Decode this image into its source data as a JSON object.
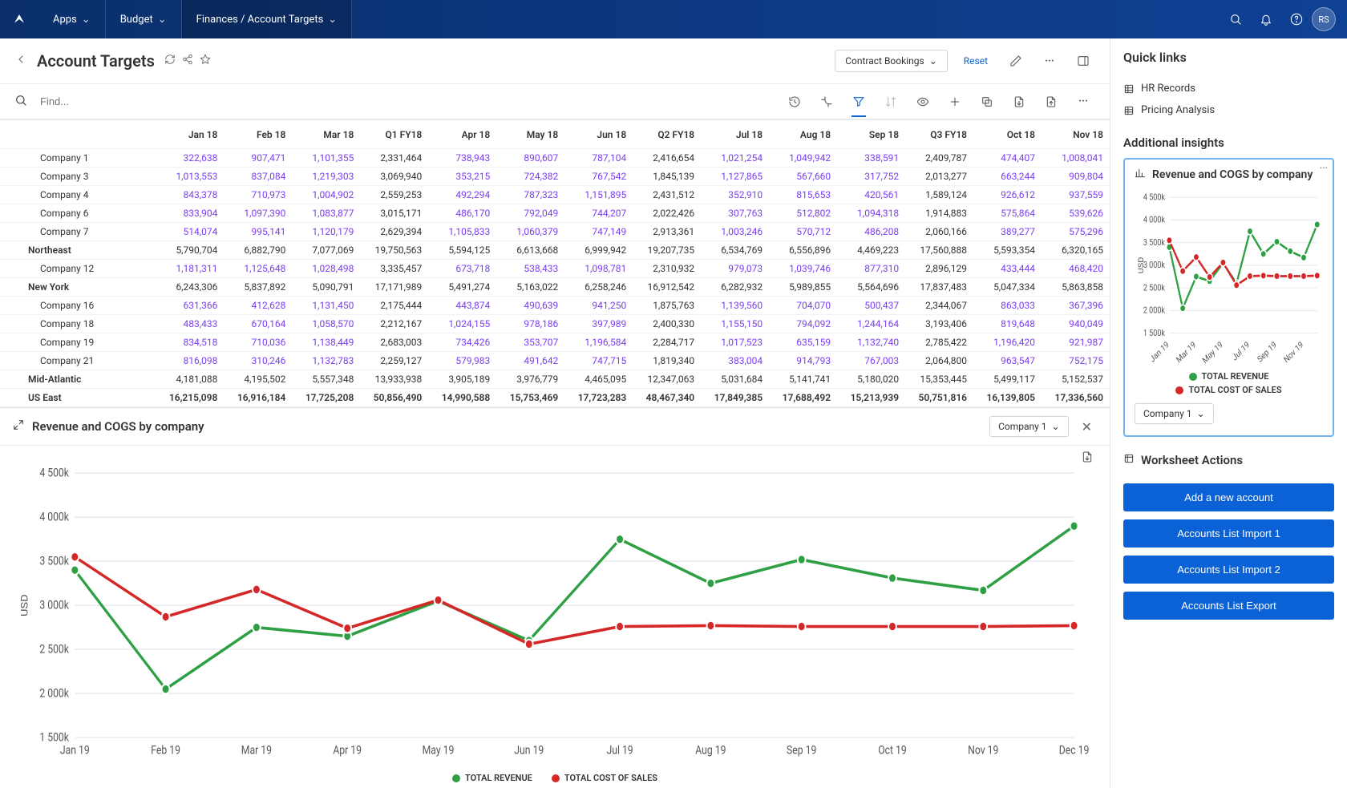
{
  "topbar": {
    "apps_label": "Apps",
    "budget_label": "Budget",
    "breadcrumb": "Finances / Account Targets",
    "avatar_initials": "RS"
  },
  "page": {
    "title": "Account Targets",
    "dropdown_label": "Contract Bookings",
    "reset_label": "Reset"
  },
  "search": {
    "placeholder": "Find..."
  },
  "table": {
    "columns": [
      "",
      "Jan 18",
      "Feb 18",
      "Mar 18",
      "Q1 FY18",
      "Apr 18",
      "May 18",
      "Jun 18",
      "Q2 FY18",
      "Jul 18",
      "Aug 18",
      "Sep 18",
      "Q3 FY18",
      "Oct 18",
      "Nov 18"
    ],
    "filtered_col": 3,
    "rows": [
      {
        "label": "Company 1",
        "group": false,
        "link": true,
        "values": [
          "322,638",
          "907,471",
          "1,101,355",
          "2,331,464",
          "738,943",
          "890,607",
          "787,104",
          "2,416,654",
          "1,021,254",
          "1,049,942",
          "338,591",
          "2,409,787",
          "474,407",
          "1,008,041"
        ]
      },
      {
        "label": "Company 3",
        "group": false,
        "link": true,
        "values": [
          "1,013,553",
          "837,084",
          "1,219,303",
          "3,069,940",
          "353,215",
          "724,382",
          "767,542",
          "1,845,139",
          "1,127,865",
          "567,660",
          "317,752",
          "2,013,277",
          "663,244",
          "909,804"
        ]
      },
      {
        "label": "Company 4",
        "group": false,
        "link": true,
        "values": [
          "843,378",
          "710,973",
          "1,004,902",
          "2,559,253",
          "492,294",
          "787,323",
          "1,151,895",
          "2,431,512",
          "352,910",
          "815,653",
          "420,561",
          "1,589,124",
          "926,612",
          "937,559"
        ]
      },
      {
        "label": "Company 6",
        "group": false,
        "link": true,
        "values": [
          "833,904",
          "1,097,390",
          "1,083,877",
          "3,015,171",
          "486,170",
          "792,049",
          "744,207",
          "2,022,426",
          "307,763",
          "512,802",
          "1,094,318",
          "1,914,883",
          "575,864",
          "539,626"
        ]
      },
      {
        "label": "Company 7",
        "group": false,
        "link": true,
        "values": [
          "514,074",
          "995,141",
          "1,120,179",
          "2,629,394",
          "1,105,833",
          "1,060,379",
          "747,149",
          "2,913,361",
          "1,003,246",
          "570,712",
          "486,208",
          "2,060,166",
          "389,277",
          "575,296"
        ]
      },
      {
        "label": "Northeast",
        "group": true,
        "link": false,
        "values": [
          "5,790,704",
          "6,882,790",
          "7,077,069",
          "19,750,563",
          "5,594,125",
          "6,613,668",
          "6,999,942",
          "19,207,735",
          "6,534,769",
          "6,556,896",
          "4,469,223",
          "17,560,888",
          "5,593,354",
          "6,320,165"
        ]
      },
      {
        "label": "Company 12",
        "group": false,
        "link": true,
        "values": [
          "1,181,311",
          "1,125,648",
          "1,028,498",
          "3,335,457",
          "673,718",
          "538,433",
          "1,098,781",
          "2,310,932",
          "979,073",
          "1,039,746",
          "877,310",
          "2,896,129",
          "433,444",
          "468,420"
        ]
      },
      {
        "label": "New York",
        "group": true,
        "link": false,
        "values": [
          "6,243,306",
          "5,837,892",
          "5,090,791",
          "17,171,989",
          "5,491,274",
          "5,163,022",
          "6,258,246",
          "16,912,542",
          "6,282,932",
          "5,989,855",
          "5,564,696",
          "17,837,483",
          "5,047,334",
          "5,863,858"
        ]
      },
      {
        "label": "Company 16",
        "group": false,
        "link": true,
        "values": [
          "631,366",
          "412,628",
          "1,131,450",
          "2,175,444",
          "443,874",
          "490,639",
          "941,250",
          "1,875,763",
          "1,139,560",
          "704,070",
          "500,437",
          "2,344,067",
          "863,033",
          "367,396"
        ]
      },
      {
        "label": "Company 18",
        "group": false,
        "link": true,
        "values": [
          "483,433",
          "670,164",
          "1,058,570",
          "2,212,167",
          "1,024,155",
          "978,186",
          "397,989",
          "2,400,330",
          "1,155,150",
          "794,092",
          "1,244,164",
          "3,193,406",
          "819,648",
          "940,049"
        ]
      },
      {
        "label": "Company 19",
        "group": false,
        "link": true,
        "values": [
          "834,518",
          "710,036",
          "1,138,449",
          "2,683,003",
          "734,426",
          "353,707",
          "1,196,584",
          "2,284,717",
          "1,017,523",
          "635,159",
          "1,132,740",
          "2,785,422",
          "1,196,420",
          "921,987"
        ]
      },
      {
        "label": "Company 21",
        "group": false,
        "link": true,
        "values": [
          "816,098",
          "310,246",
          "1,132,783",
          "2,259,127",
          "579,983",
          "491,642",
          "747,715",
          "1,819,340",
          "383,004",
          "914,793",
          "767,003",
          "2,064,800",
          "963,547",
          "752,175"
        ]
      },
      {
        "label": "Mid-Atlantic",
        "group": true,
        "link": false,
        "values": [
          "4,181,088",
          "4,195,502",
          "5,557,348",
          "13,933,938",
          "3,905,189",
          "3,976,779",
          "4,465,095",
          "12,347,063",
          "5,031,684",
          "5,141,741",
          "5,180,020",
          "15,353,445",
          "5,499,117",
          "5,152,537"
        ]
      },
      {
        "label": "US East",
        "group": true,
        "total": true,
        "link": false,
        "values": [
          "16,215,098",
          "16,916,184",
          "17,725,208",
          "50,856,490",
          "14,990,588",
          "15,753,469",
          "17,723,283",
          "48,467,340",
          "17,849,385",
          "17,688,492",
          "15,213,939",
          "50,751,816",
          "16,139,805",
          "17,336,560"
        ]
      }
    ],
    "link_cols": [
      1,
      2,
      3,
      5,
      6,
      7,
      9,
      10,
      11,
      13,
      14
    ]
  },
  "chart_data": {
    "type": "line",
    "title": "Revenue and COGS by company",
    "selector": "Company 1",
    "ylabel": "USD",
    "xlabels": [
      "Jan 19",
      "Feb 19",
      "Mar 19",
      "Apr 19",
      "May 19",
      "Jun 19",
      "Jul 19",
      "Aug 19",
      "Sep 19",
      "Oct 19",
      "Nov 19",
      "Dec 19"
    ],
    "yticks": [
      "1 500k",
      "2 000k",
      "2 500k",
      "3 000k",
      "3 500k",
      "4 000k",
      "4 500k"
    ],
    "ymin": 1500,
    "ymax": 4500,
    "series": [
      {
        "name": "TOTAL REVENUE",
        "color": "#2ea043",
        "values": [
          3400,
          2050,
          2750,
          2650,
          3050,
          2600,
          3750,
          3250,
          3520,
          3310,
          3170,
          3900
        ]
      },
      {
        "name": "TOTAL COST OF SALES",
        "color": "#d62728",
        "values": [
          3550,
          2870,
          3180,
          2740,
          3060,
          2560,
          2760,
          2770,
          2760,
          2760,
          2760,
          2770
        ]
      }
    ]
  },
  "mini_chart": {
    "type": "line",
    "title": "Revenue and COGS by company",
    "ylabel": "USD",
    "xlabels": [
      "Jan 19",
      "Mar 19",
      "May 19",
      "Jul 19",
      "Sep 19",
      "Nov 19"
    ],
    "xfull": [
      "Jan 19",
      "Feb 19",
      "Mar 19",
      "Apr 19",
      "May 19",
      "Jun 19",
      "Jul 19",
      "Aug 19",
      "Sep 19",
      "Oct 19",
      "Nov 19",
      "Dec 19"
    ],
    "yticks": [
      "1 500k",
      "2 000k",
      "2 500k",
      "3 000k",
      "3 500k",
      "4 000k",
      "4 500k"
    ],
    "ymin": 1500,
    "ymax": 4500,
    "selector": "Company 1",
    "series": [
      {
        "name": "TOTAL REVENUE",
        "color": "#2ea043",
        "values": [
          3400,
          2050,
          2750,
          2650,
          3050,
          2600,
          3750,
          3250,
          3520,
          3310,
          3170,
          3900
        ]
      },
      {
        "name": "TOTAL COST OF SALES",
        "color": "#d62728",
        "values": [
          3550,
          2870,
          3180,
          2740,
          3060,
          2560,
          2760,
          2770,
          2760,
          2760,
          2760,
          2770
        ]
      }
    ]
  },
  "side": {
    "quick_links_heading": "Quick links",
    "quick_links": [
      "HR Records",
      "Pricing Analysis"
    ],
    "insights_heading": "Additional insights",
    "worksheet_actions_heading": "Worksheet Actions",
    "actions": [
      "Add a new account",
      "Accounts List Import 1",
      "Accounts List Import 2",
      "Accounts List Export"
    ]
  }
}
